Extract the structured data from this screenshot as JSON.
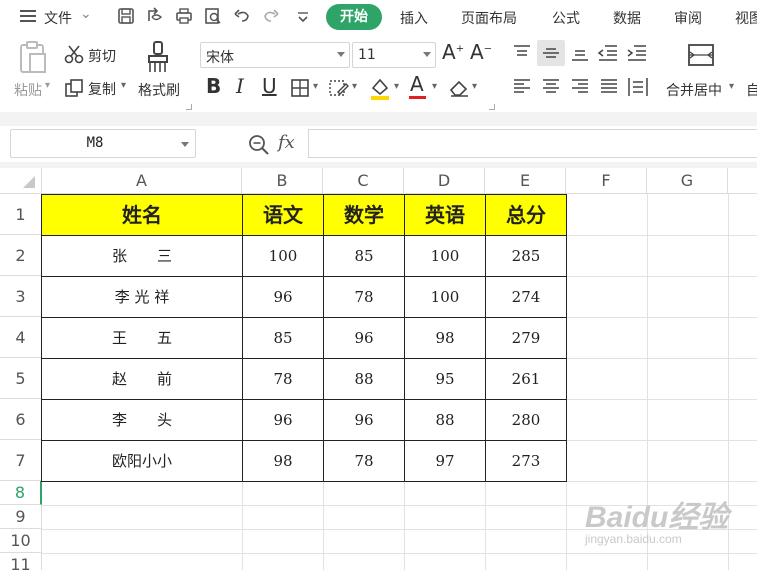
{
  "menu": {
    "file": "文件",
    "tabs": [
      "开始",
      "插入",
      "页面布局",
      "公式",
      "数据",
      "审阅",
      "视图"
    ],
    "active_tab": "开始"
  },
  "ribbon": {
    "paste": "粘贴",
    "cut": "剪切",
    "copy": "复制",
    "format_painter": "格式刷",
    "font_name": "宋体",
    "font_size": "11",
    "merge_center": "合并居中",
    "auto_wrap_partial": "自"
  },
  "formula_bar": {
    "name_box": "M8",
    "fx": "fx",
    "formula": ""
  },
  "sheet": {
    "columns": [
      "A",
      "B",
      "C",
      "D",
      "E",
      "F",
      "G"
    ],
    "rows": [
      "1",
      "2",
      "3",
      "4",
      "5",
      "6",
      "7",
      "8",
      "9",
      "10",
      "11"
    ],
    "active_row": "8",
    "table_header": [
      "姓名",
      "语文",
      "数学",
      "英语",
      "总分"
    ],
    "table_rows": [
      [
        "张　　三",
        "100",
        "85",
        "100",
        "285"
      ],
      [
        "李 光 祥",
        "96",
        "78",
        "100",
        "274"
      ],
      [
        "王　　五",
        "85",
        "96",
        "98",
        "279"
      ],
      [
        "赵　　前",
        "78",
        "88",
        "95",
        "261"
      ],
      [
        "李　　头",
        "96",
        "96",
        "88",
        "280"
      ],
      [
        "欧阳小小",
        "98",
        "78",
        "97",
        "273"
      ]
    ],
    "header_fill": "#ffff00"
  },
  "colors": {
    "accent_green": "#2ea468"
  },
  "watermark": {
    "brand": "Baidu经验",
    "url": "jingyan.baidu.com"
  }
}
